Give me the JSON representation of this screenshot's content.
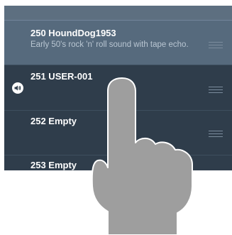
{
  "presets": [
    {
      "number": "250",
      "name": "HoundDog1953",
      "description": "Early 50's rock 'n' roll sound with tape echo.",
      "state": "selected"
    },
    {
      "number": "251",
      "name": "USER-001",
      "description": "",
      "state": "playing"
    },
    {
      "number": "252",
      "name": "Empty",
      "description": "",
      "state": "normal"
    },
    {
      "number": "253",
      "name": "Empty",
      "description": "",
      "state": "normal"
    }
  ],
  "labels": {
    "row0": "250 HoundDog1953",
    "row1": "251 USER-001",
    "row2": "252 Empty",
    "row3": "253 Empty"
  },
  "icons": {
    "speaker": "speaker-icon",
    "handle": "drag-handle-icon",
    "gesture": "finger-touch-icon"
  },
  "colors": {
    "selected_row": "#566a7d",
    "normal_row": "#2f3d4b",
    "text_primary": "#ffffff",
    "text_secondary": "#b9c6d2",
    "hand_fill": "#9e9e9e"
  }
}
